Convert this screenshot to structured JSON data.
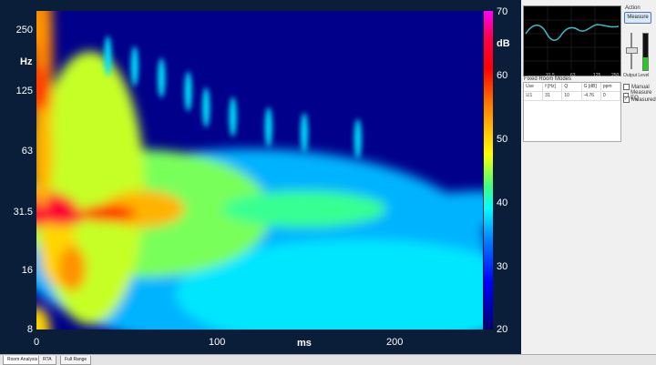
{
  "chart_data": {
    "type": "heatmap",
    "title": "",
    "xlabel": "ms",
    "ylabel": "Hz",
    "x_ticks": [
      "0",
      "100",
      "200"
    ],
    "y_ticks": [
      "250",
      "125",
      "63",
      "31.5",
      "16",
      "8"
    ],
    "xlim": [
      0,
      250
    ],
    "ylim": [
      8,
      300
    ],
    "y_scale": "log",
    "colorbar": {
      "label": "dB",
      "ticks": [
        "70",
        "60",
        "50",
        "40",
        "30",
        "20"
      ],
      "range": [
        20,
        70
      ]
    },
    "features": [
      {
        "freq_hz": 31.5,
        "time_ms": 0,
        "level_db": 64
      },
      {
        "freq_hz": 31.5,
        "time_ms": 60,
        "level_db": 52
      },
      {
        "freq_hz": 31.5,
        "time_ms": 150,
        "level_db": 42
      },
      {
        "freq_hz": 31.5,
        "time_ms": 250,
        "level_db": 36
      },
      {
        "freq_hz": 125,
        "time_ms": 0,
        "level_db": 58
      },
      {
        "freq_hz": 250,
        "time_ms": 0,
        "level_db": 54
      },
      {
        "freq_hz": 16,
        "time_ms": 20,
        "level_db": 54
      },
      {
        "freq_hz": 8,
        "time_ms": 0,
        "level_db": 50
      }
    ]
  },
  "axis": {
    "hz_unit": "Hz",
    "ms_unit": "ms",
    "db_unit": "dB"
  },
  "mini_chart": {
    "ticks": [
      "31.5",
      "63",
      "125",
      "250"
    ]
  },
  "modes": {
    "title": "Fixed Room Modes",
    "headers": [
      "Use",
      "f [Hz]",
      "Q",
      "G [dB]",
      "ppm"
    ],
    "rows": [
      [
        "☑1",
        "31",
        "10",
        "-4.76",
        "0"
      ]
    ]
  },
  "controls": {
    "action_label": "Action",
    "measure_button": "Measure",
    "output_level_label": "Output Level",
    "checkboxes": [
      {
        "label": "Manual",
        "checked": false
      },
      {
        "label": "Measure EQ",
        "checked": false
      },
      {
        "label": "Measured",
        "checked": true
      }
    ]
  },
  "tabs": [
    {
      "label": "Room Analysis",
      "active": true
    },
    {
      "label": "RTA",
      "active": false
    },
    {
      "label": "Full Range",
      "active": false
    }
  ]
}
